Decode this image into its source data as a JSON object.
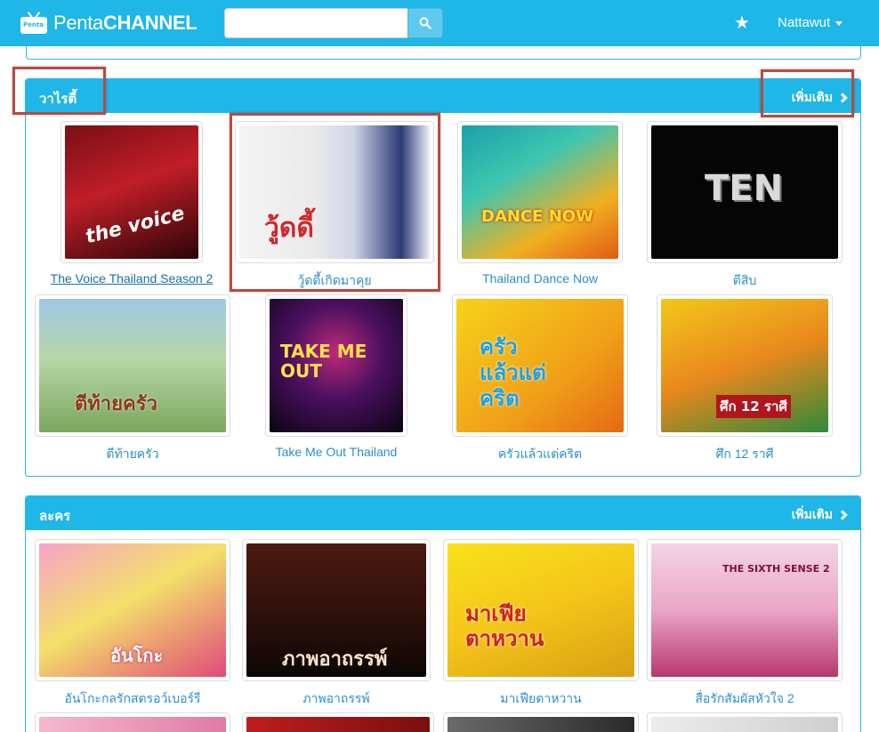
{
  "brand": {
    "prefix": "Penta",
    "suffix": "CHANNEL",
    "icon_text": "Penta"
  },
  "search": {
    "value": "",
    "placeholder": ""
  },
  "nav": {
    "star_icon": "★",
    "user": "Nattawut"
  },
  "sections": [
    {
      "title": "วาไรตี้",
      "more": "เพิ่มเติม",
      "items": [
        {
          "caption": "The Voice Thailand Season 2",
          "art": "the voice"
        },
        {
          "caption": "วู้ดดี้เกิดมาคุย",
          "art": "วู้ดดี้"
        },
        {
          "caption": "Thailand Dance Now",
          "art": "DANCE NOW"
        },
        {
          "caption": "ตีสิบ",
          "art": "TEN"
        },
        {
          "caption": "ตีท้ายครัว",
          "art": "ตีท้ายครัว"
        },
        {
          "caption": "Take Me Out Thailand",
          "art": "TAKE ME OUT"
        },
        {
          "caption": "ครัวแล้วแต่คริต",
          "art": "ครัว แล้วแต่ คริต"
        },
        {
          "caption": "ศึก 12 ราศี",
          "art": "ศึก 12 ราศี"
        }
      ]
    },
    {
      "title": "ละคร",
      "more": "เพิ่มเติม",
      "items": [
        {
          "caption": "อันโกะกลรักสตรอว์เบอร์รี",
          "art": "อันโกะ"
        },
        {
          "caption": "ภาพอาถรรพ์",
          "art": "ภาพอาถรรพ์"
        },
        {
          "caption": "มาเฟียตาหวาน",
          "art": "มาเฟีย ตาหวาน"
        },
        {
          "caption": "สื่อรักสัมผัสหัวใจ 2",
          "art": "THE SIXTH SENSE 2"
        }
      ]
    }
  ],
  "colors": {
    "primary": "#1fb6e8",
    "link": "#2a8fc9",
    "highlight": "#b94a3e"
  }
}
